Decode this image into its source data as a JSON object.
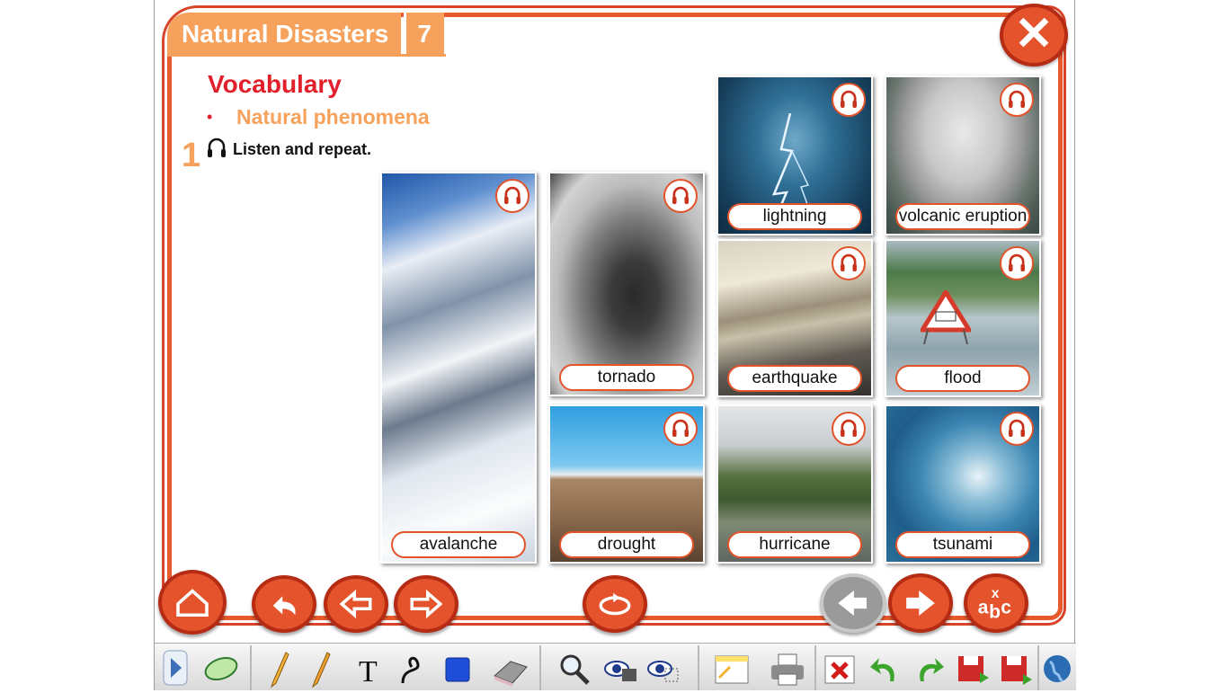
{
  "header": {
    "title": "Natural Disasters",
    "unit": "7"
  },
  "section": {
    "heading": "Vocabulary",
    "bullet": "•",
    "subheading": "Natural phenomena"
  },
  "exercise": {
    "number": "1",
    "instruction": "Listen and repeat."
  },
  "cards": [
    {
      "label": "avalanche"
    },
    {
      "label": "tornado"
    },
    {
      "label": "drought"
    },
    {
      "label": "lightning"
    },
    {
      "label": "volcanic eruption"
    },
    {
      "label": "earthquake"
    },
    {
      "label": "flood"
    },
    {
      "label": "hurricane"
    },
    {
      "label": "tsunami"
    }
  ],
  "colors": {
    "accent": "#e4532c",
    "title_tab": "#f6a25c",
    "heading": "#e2202c"
  },
  "icons": {
    "close": "close-icon",
    "audio": "headphones-icon",
    "home": "home-icon",
    "back": "undo-arrow-icon",
    "prev": "arrow-left-icon",
    "next": "arrow-right-icon",
    "refresh": "refresh-icon",
    "page_prev": "arrow-left-icon",
    "page_next": "arrow-right-icon",
    "dictionary": "abc-icon"
  }
}
